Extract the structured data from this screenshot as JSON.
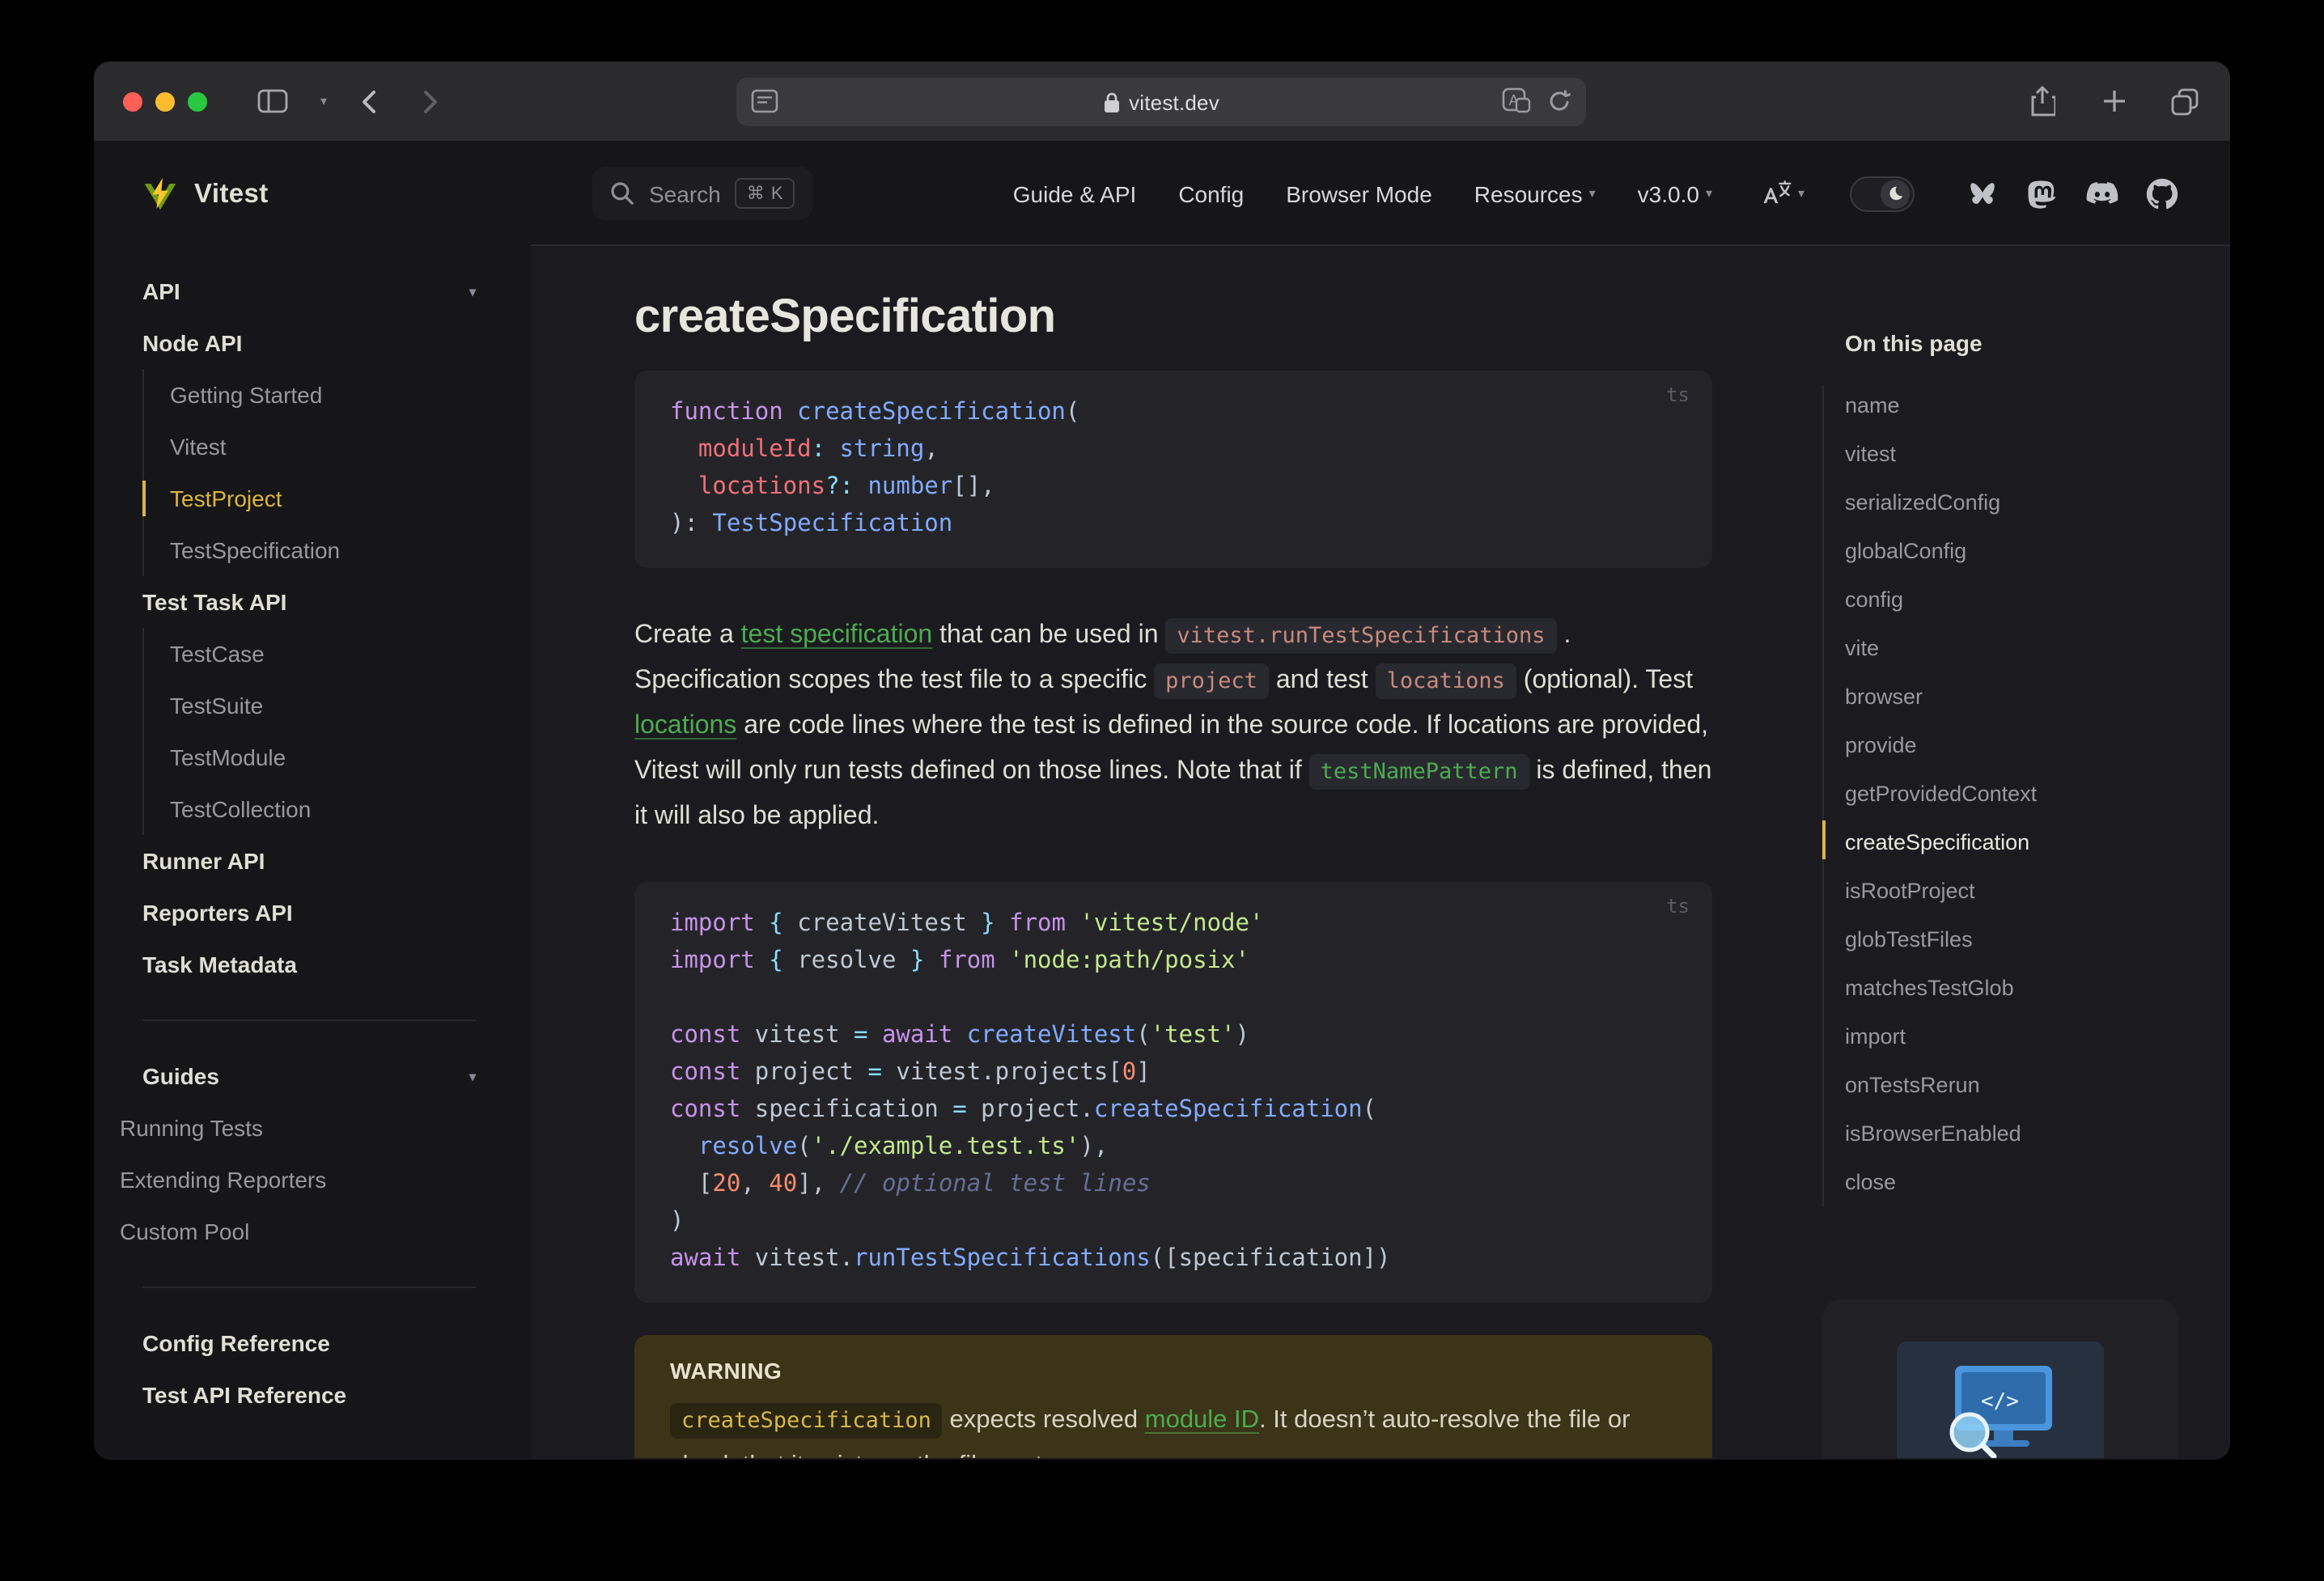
{
  "palette": {
    "window-bg": "#1b1b1f",
    "panel-bg": "#161618",
    "toolbar-bg": "#2b2b2d",
    "urlbar-bg": "#3a3a3e",
    "code-bg": "#242428",
    "divider": "#2a2a2e",
    "text-1": "#dfdfd6",
    "text-2": "#98989f",
    "brand-yellow": "#dcb63f",
    "logo-yellow": "#fcc72b",
    "logo-green": "#729b1a",
    "link-green": "#4cab50",
    "warning-bg": "#3b3418",
    "warning-text": "#d8d3c2",
    "inline-code": "#c98a7d",
    "tok-kw": "#c792ea",
    "tok-fn": "#82aaff",
    "tok-st": "#c3e88d",
    "tok-nu": "#f78c6c",
    "tok-cm": "#676e95",
    "tok-pr": "#f07178",
    "tok-op": "#89ddff",
    "tok-ty": "#82aaff",
    "tok-df": "#bfc7d5",
    "traffic-red": "#ff5f57",
    "traffic-yellow": "#febc2e",
    "traffic-green": "#28c840"
  },
  "browser": {
    "url": "vitest.dev"
  },
  "topnav": {
    "search": {
      "label": "Search",
      "shortcut": "⌘ K"
    },
    "links": [
      {
        "label": "Guide & API"
      },
      {
        "label": "Config"
      },
      {
        "label": "Browser Mode"
      },
      {
        "label": "Resources"
      },
      {
        "label": "v3.0.0"
      }
    ]
  },
  "sidebar": {
    "logo_text": "Vitest",
    "groups": {
      "api_title": "API",
      "node_api_title": "Node API",
      "node_api_items": [
        "Getting Started",
        "Vitest",
        "TestProject",
        "TestSpecification"
      ],
      "task_api_title": "Test Task API",
      "task_api_items": [
        "TestCase",
        "TestSuite",
        "TestModule",
        "TestCollection"
      ],
      "top_links": [
        "Runner API",
        "Reporters API",
        "Task Metadata"
      ],
      "guides_title": "Guides",
      "guides_items": [
        "Running Tests",
        "Extending Reporters",
        "Custom Pool"
      ],
      "ref_links": [
        "Config Reference",
        "Test API Reference"
      ]
    }
  },
  "main": {
    "title": "createSpecification",
    "code1": {
      "lang": "ts",
      "lines": [
        [
          {
            "c": "kw",
            "t": "function"
          },
          {
            "c": "fn",
            "t": " createSpecification"
          },
          {
            "c": "df",
            "t": "("
          }
        ],
        [
          {
            "c": "pr",
            "t": "  moduleId"
          },
          {
            "c": "op",
            "t": ":"
          },
          {
            "c": "ty",
            "t": " string"
          },
          {
            "c": "df",
            "t": ","
          }
        ],
        [
          {
            "c": "pr",
            "t": "  locations"
          },
          {
            "c": "op",
            "t": "?:"
          },
          {
            "c": "ty",
            "t": " number"
          },
          {
            "c": "df",
            "t": "[],"
          }
        ],
        [
          {
            "c": "df",
            "t": "): "
          },
          {
            "c": "ty",
            "t": "TestSpecification"
          }
        ]
      ]
    },
    "paragraph": [
      {
        "t": "Create a "
      },
      {
        "t": "test specification",
        "s": "link"
      },
      {
        "t": " that can be used in "
      },
      {
        "t": "vitest.runTestSpecifications",
        "s": "code"
      },
      {
        "t": " . Specification scopes the test file to a specific "
      },
      {
        "t": "project",
        "s": "code"
      },
      {
        "t": " and test "
      },
      {
        "t": "locations",
        "s": "code"
      },
      {
        "t": " (optional). Test "
      },
      {
        "t": "locations",
        "s": "link"
      },
      {
        "t": " are code lines where the test is defined in the source code. If locations are provided, Vitest will only run tests defined on those lines. Note that if "
      },
      {
        "t": "testNamePattern",
        "s": "codegreen"
      },
      {
        "t": " is defined, then it will also be applied."
      }
    ],
    "code2": {
      "lang": "ts",
      "lines": [
        [
          {
            "c": "kw",
            "t": "import"
          },
          {
            "c": "op",
            "t": " { "
          },
          {
            "c": "df",
            "t": "createVitest"
          },
          {
            "c": "op",
            "t": " } "
          },
          {
            "c": "kw",
            "t": "from"
          },
          {
            "c": "st",
            "t": " 'vitest/node'"
          }
        ],
        [
          {
            "c": "kw",
            "t": "import"
          },
          {
            "c": "op",
            "t": " { "
          },
          {
            "c": "df",
            "t": "resolve"
          },
          {
            "c": "op",
            "t": " } "
          },
          {
            "c": "kw",
            "t": "from"
          },
          {
            "c": "st",
            "t": " 'node:path/posix'"
          }
        ],
        [],
        [
          {
            "c": "kw",
            "t": "const"
          },
          {
            "c": "df",
            "t": " vitest "
          },
          {
            "c": "op",
            "t": "="
          },
          {
            "c": "df",
            "t": " "
          },
          {
            "c": "kw",
            "t": "await"
          },
          {
            "c": "fn",
            "t": " createVitest"
          },
          {
            "c": "df",
            "t": "("
          },
          {
            "c": "st",
            "t": "'test'"
          },
          {
            "c": "df",
            "t": ")"
          }
        ],
        [
          {
            "c": "kw",
            "t": "const"
          },
          {
            "c": "df",
            "t": " project "
          },
          {
            "c": "op",
            "t": "="
          },
          {
            "c": "df",
            "t": " vitest.projects["
          },
          {
            "c": "nu",
            "t": "0"
          },
          {
            "c": "df",
            "t": "]"
          }
        ],
        [
          {
            "c": "kw",
            "t": "const"
          },
          {
            "c": "df",
            "t": " specification "
          },
          {
            "c": "op",
            "t": "="
          },
          {
            "c": "df",
            "t": " project."
          },
          {
            "c": "fn",
            "t": "createSpecification"
          },
          {
            "c": "df",
            "t": "("
          }
        ],
        [
          {
            "c": "df",
            "t": "  "
          },
          {
            "c": "fn",
            "t": "resolve"
          },
          {
            "c": "df",
            "t": "("
          },
          {
            "c": "st",
            "t": "'./example.test.ts'"
          },
          {
            "c": "df",
            "t": "),"
          }
        ],
        [
          {
            "c": "df",
            "t": "  ["
          },
          {
            "c": "nu",
            "t": "20"
          },
          {
            "c": "df",
            "t": ", "
          },
          {
            "c": "nu",
            "t": "40"
          },
          {
            "c": "df",
            "t": "], "
          },
          {
            "c": "cm",
            "t": "// optional test lines"
          }
        ],
        [
          {
            "c": "df",
            "t": ")"
          }
        ],
        [
          {
            "c": "kw",
            "t": "await"
          },
          {
            "c": "df",
            "t": " vitest."
          },
          {
            "c": "fn",
            "t": "runTestSpecifications"
          },
          {
            "c": "df",
            "t": "(["
          },
          {
            "c": "df",
            "t": "specification"
          },
          {
            "c": "df",
            "t": "])"
          }
        ]
      ]
    },
    "warning": {
      "title": "WARNING",
      "body": [
        {
          "t": "createSpecification",
          "s": "wcode"
        },
        {
          "t": " expects resolved "
        },
        {
          "t": "module ID",
          "s": "link"
        },
        {
          "t": ". It doesn’t auto-resolve the file or check that it exists on the file system."
        }
      ]
    }
  },
  "toc": {
    "title": "On this page",
    "items": [
      "name",
      "vitest",
      "serializedConfig",
      "globalConfig",
      "config",
      "vite",
      "browser",
      "provide",
      "getProvidedContext",
      "createSpecification",
      "isRootProject",
      "globTestFiles",
      "matchesTestGlob",
      "import",
      "onTestsRerun",
      "isBrowserEnabled",
      "close"
    ],
    "active": "createSpecification"
  },
  "promo": {
    "image": "monitor-code-magnifier-illustration"
  }
}
